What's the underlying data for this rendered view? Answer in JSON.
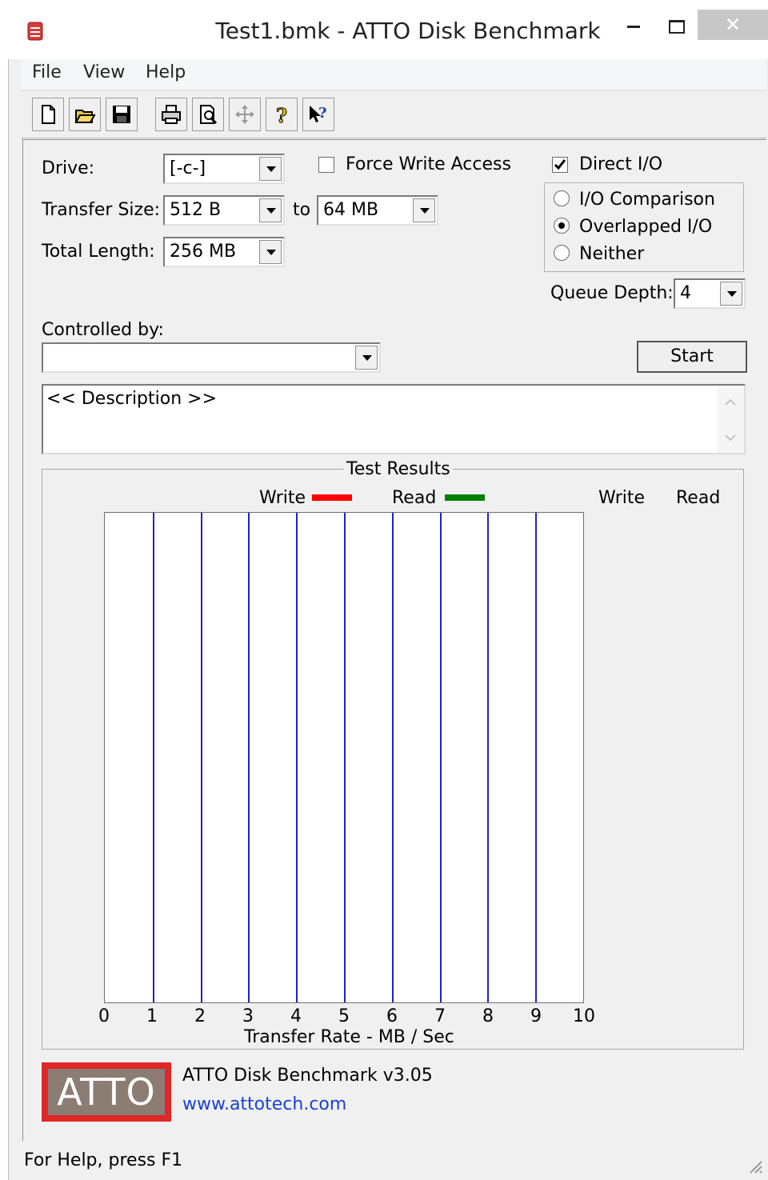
{
  "window": {
    "title": "Test1.bmk - ATTO Disk Benchmark"
  },
  "menu": [
    "File",
    "View",
    "Help"
  ],
  "toolbar": [
    "new-icon",
    "open-icon",
    "save-icon",
    "print-icon",
    "print-preview-icon",
    "move-icon",
    "help-icon",
    "context-help-icon"
  ],
  "form": {
    "drive_label": "Drive:",
    "drive_value": "[-c-]",
    "transfer_size_label": "Transfer Size:",
    "transfer_from": "512 B",
    "to_label": "to",
    "transfer_to": "64 MB",
    "total_length_label": "Total Length:",
    "total_length": "256 MB",
    "force_write_label": "Force Write Access",
    "force_write_checked": false,
    "direct_io_label": "Direct I/O",
    "direct_io_checked": true,
    "io_options": [
      {
        "label": "I/O Comparison",
        "selected": false
      },
      {
        "label": "Overlapped I/O",
        "selected": true
      },
      {
        "label": "Neither",
        "selected": false
      }
    ],
    "queue_depth_label": "Queue Depth:",
    "queue_depth": "4",
    "controlled_by_label": "Controlled by:",
    "controlled_by_value": "",
    "start_button": "Start",
    "description": "<< Description >>"
  },
  "results": {
    "title": "Test Results",
    "legend_write": "Write",
    "legend_read": "Read",
    "col_write": "Write",
    "col_read": "Read",
    "write_color": "#ff0000",
    "read_color": "#008000",
    "x_ticks": [
      "0",
      "1",
      "2",
      "3",
      "4",
      "5",
      "6",
      "7",
      "8",
      "9",
      "10"
    ],
    "x_label": "Transfer Rate - MB / Sec"
  },
  "chart_data": {
    "type": "bar",
    "title": "Test Results",
    "xlabel": "Transfer Rate - MB / Sec",
    "xlim": [
      0,
      10
    ],
    "series": [
      {
        "name": "Write",
        "values": []
      },
      {
        "name": "Read",
        "values": []
      }
    ]
  },
  "footer": {
    "logo_text": "ATTO",
    "product": "ATTO Disk Benchmark v3.05",
    "url": "www.attotech.com"
  },
  "status": {
    "text": "For Help, press F1"
  }
}
